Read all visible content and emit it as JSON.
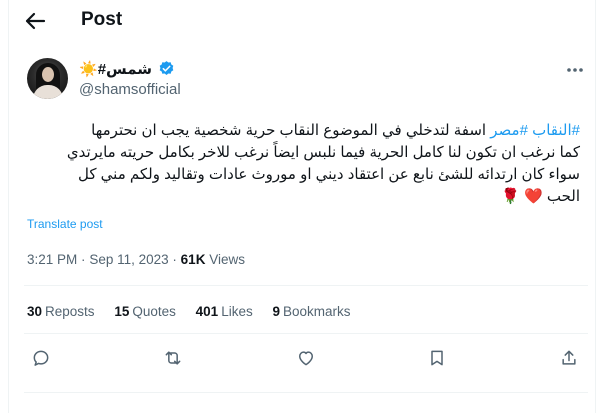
{
  "header": {
    "title": "Post",
    "back_icon": "arrow-left-icon"
  },
  "author": {
    "name_text": "#شمس",
    "name_emoji": "☀️",
    "verified_icon": "verified-badge-icon",
    "handle": "@shamsofficial",
    "more_icon": "more-horizontal-icon"
  },
  "tweet": {
    "hashtag_1": "#النقاب",
    "hashtag_2": "#مصر",
    "line_1": " اسفة لتدخلي في الموضوع النقاب حرية شخصية  يجب ان نحترمها",
    "line_2": "كما نرغب ان تكون لنا كامل الحرية فيما نلبس  ايضاً  نرغب للاخر بكامل حريته مايرتدي",
    "line_3": "سواء كان ارتدائه للشئ نابع عن اعتقاد ديني او  موروث  عادات وتقاليد  ولكم مني كل",
    "line_4": "الحب",
    "emoji_heart": "❤️",
    "emoji_rose": "🌹"
  },
  "translate_label": "Translate post",
  "meta": {
    "time": "3:21 PM",
    "separator": "·",
    "date": "Sep 11, 2023",
    "views_count": "61K",
    "views_label": "Views"
  },
  "stats": {
    "reposts_count": "30",
    "reposts_label": "Reposts",
    "quotes_count": "15",
    "quotes_label": "Quotes",
    "likes_count": "401",
    "likes_label": "Likes",
    "bookmarks_count": "9",
    "bookmarks_label": "Bookmarks"
  },
  "actions": [
    "reply-icon",
    "repost-icon",
    "like-icon",
    "bookmark-icon",
    "share-icon"
  ],
  "colors": {
    "accent": "#1d9bf0",
    "text_primary": "#0f1419",
    "text_secondary": "#536471",
    "divider": "#eff3f4",
    "verified": "#1d9bf0"
  }
}
